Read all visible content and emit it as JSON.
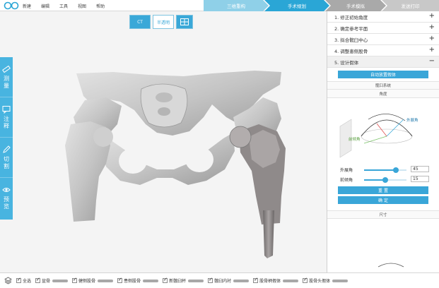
{
  "menu": [
    "新建",
    "编辑",
    "工具",
    "视图",
    "帮助"
  ],
  "steps": [
    "三维重构",
    "手术规划",
    "手术模拟",
    "发送打印"
  ],
  "view_buttons": {
    "ct": "CT",
    "translucent": "半透明",
    "layout_icon": "layout-icon"
  },
  "left_tools": [
    {
      "label": "测量",
      "icon": "ruler-icon"
    },
    {
      "label": "注释",
      "icon": "comment-icon"
    },
    {
      "label": "切割",
      "icon": "pen-icon"
    },
    {
      "label": "预览",
      "icon": "eye-icon"
    }
  ],
  "panel": {
    "items": [
      {
        "label": "1. 修正初始角度",
        "sign": "+"
      },
      {
        "label": "2. 确定参考平面",
        "sign": "+"
      },
      {
        "label": "3. 拟合髋臼中心",
        "sign": "+"
      },
      {
        "label": "4. 调整患侧股骨",
        "sign": "+"
      },
      {
        "label": "5. 设计假体",
        "sign": "−"
      }
    ],
    "auto_button": "自动放置假体",
    "acetabular_system": "髋臼系统",
    "angle_header": "角度",
    "gizmo_labels": {
      "abduction": "外展角",
      "anteversion": "前倾角"
    },
    "abduction": {
      "label": "外展角",
      "value": "45",
      "fraction": 0.75
    },
    "anteversion": {
      "label": "前倾角",
      "value": "15",
      "fraction": 0.5
    },
    "reset_button": "重 置",
    "confirm_button": "确 定",
    "size_header": "尺寸"
  },
  "bottom": {
    "items": [
      "全选",
      "盆骨",
      "健侧股骨",
      "患侧股骨",
      "新髋臼杯",
      "髋臼内衬",
      "股骨柄假体",
      "股骨头假体"
    ]
  },
  "colors": {
    "accent": "#39a6d8",
    "bone": "#c9c9c9",
    "implant": "#8a8585"
  }
}
